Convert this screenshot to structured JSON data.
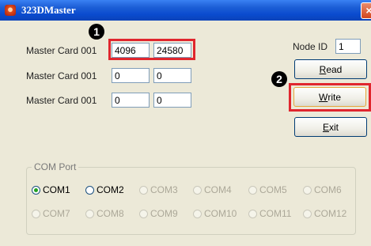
{
  "window": {
    "title": "323DMaster",
    "close_glyph": "×"
  },
  "rows": [
    {
      "label": "Master Card 001",
      "a": "4096",
      "b": "24580"
    },
    {
      "label": "Master Card 001",
      "a": "0",
      "b": "0"
    },
    {
      "label": "Master Card 001",
      "a": "0",
      "b": "0"
    }
  ],
  "node": {
    "label": "Node ID",
    "value": "1"
  },
  "buttons": {
    "read": {
      "mn": "R",
      "rest": "ead"
    },
    "write": {
      "mn": "W",
      "rest": "rite"
    },
    "exit": {
      "mn": "E",
      "rest": "xit"
    }
  },
  "callouts": {
    "one": "1",
    "two": "2"
  },
  "com": {
    "title": "COM Port",
    "ports": [
      {
        "label": "COM1",
        "enabled": true,
        "selected": true
      },
      {
        "label": "COM2",
        "enabled": true,
        "selected": false
      },
      {
        "label": "COM3",
        "enabled": false,
        "selected": false
      },
      {
        "label": "COM4",
        "enabled": false,
        "selected": false
      },
      {
        "label": "COM5",
        "enabled": false,
        "selected": false
      },
      {
        "label": "COM6",
        "enabled": false,
        "selected": false
      },
      {
        "label": "COM7",
        "enabled": false,
        "selected": false
      },
      {
        "label": "COM8",
        "enabled": false,
        "selected": false
      },
      {
        "label": "COM9",
        "enabled": false,
        "selected": false
      },
      {
        "label": "COM10",
        "enabled": false,
        "selected": false
      },
      {
        "label": "COM11",
        "enabled": false,
        "selected": false
      },
      {
        "label": "COM12",
        "enabled": false,
        "selected": false
      }
    ]
  },
  "colors": {
    "highlight": "#e0262e",
    "selected_dot": "#21a121",
    "titlebar": "#0a4bcf"
  }
}
